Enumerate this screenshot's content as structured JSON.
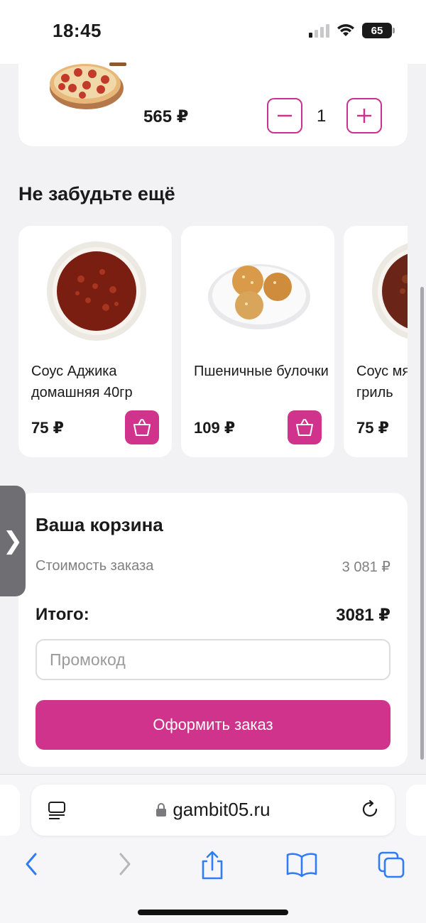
{
  "status_bar": {
    "time": "18:45",
    "battery": "65",
    "signal_bars": 4,
    "signal_active": 1,
    "icons": [
      "signal-icon",
      "wifi-icon",
      "battery-icon"
    ]
  },
  "cart_item": {
    "price": "565 ₽",
    "quantity": "1",
    "image_icon": "pizza-image"
  },
  "recommendations": {
    "title": "Не забудьте ещё",
    "items": [
      {
        "name": "Соус Аджика домашняя 40гр",
        "price": "75 ₽",
        "image": "adjika-sauce-bowl"
      },
      {
        "name": "Пшеничные булочки",
        "price": "109 ₽",
        "image": "wheat-buns-plate"
      },
      {
        "name": "Соус мя... гриль",
        "price": "75 ₽",
        "image": "sauce-bowl"
      }
    ]
  },
  "summary": {
    "title": "Ваша корзина",
    "order_cost_label": "Стоимость заказа",
    "order_cost_value": "3 081 ₽",
    "total_label": "Итого:",
    "total_value": "3081 ₽",
    "promo_placeholder": "Промокод",
    "promo_value": "",
    "checkout_label": "Оформить заказ"
  },
  "side_tab": {
    "label": "❯"
  },
  "browser": {
    "url": "gambit05.ru",
    "nav": [
      "back",
      "forward",
      "share",
      "bookmarks",
      "tabs"
    ]
  },
  "colors": {
    "accent": "#d0338c",
    "page_bg": "#f2f2f4",
    "card_bg": "#ffffff",
    "muted_text": "#808080",
    "ios_blue": "#2f7cf6"
  }
}
